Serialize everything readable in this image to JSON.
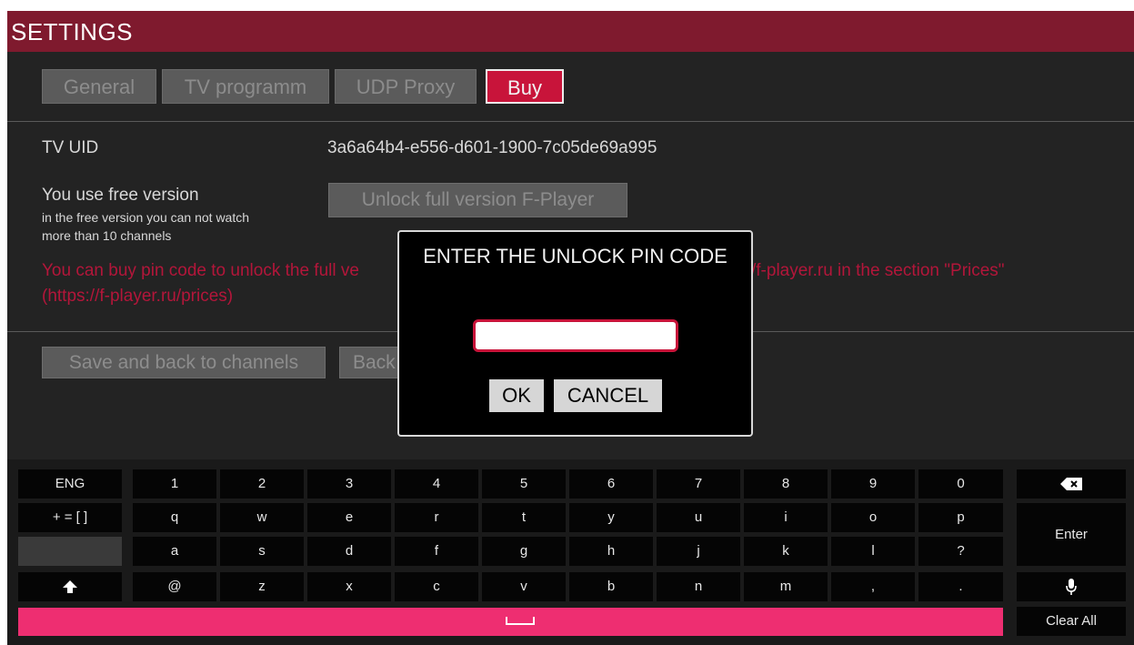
{
  "header": {
    "title": "SETTINGS"
  },
  "tabs": [
    {
      "label": "General"
    },
    {
      "label": "TV programm"
    },
    {
      "label": "UDP Proxy"
    },
    {
      "label": "Buy"
    }
  ],
  "info": {
    "uid_label": "TV UID",
    "uid_value": "3a6a64b4-e556-d601-1900-7c05de69a995",
    "free_title": "You use free version",
    "free_note_1": "in the free version you can not watch",
    "free_note_2": "more than 10 channels",
    "unlock_button": "Unlock full version F-Player",
    "buy_text_left": "You can buy pin code to unlock the full ve",
    "buy_text_right": "/f-player.ru in the section \"Prices\"",
    "buy_url": "(https://f-player.ru/prices)"
  },
  "actions": {
    "save_label": "Save and back to channels",
    "back_label": "Back"
  },
  "dialog": {
    "title": "ENTER THE UNLOCK PIN CODE",
    "pin_value": "",
    "ok": "OK",
    "cancel": "CANCEL"
  },
  "keyboard": {
    "lang": "ENG",
    "symbols": "+ = [ ]",
    "row1": [
      "1",
      "2",
      "3",
      "4",
      "5",
      "6",
      "7",
      "8",
      "9",
      "0"
    ],
    "row2": [
      "q",
      "w",
      "e",
      "r",
      "t",
      "y",
      "u",
      "i",
      "o",
      "p"
    ],
    "row3": [
      "a",
      "s",
      "d",
      "f",
      "g",
      "h",
      "j",
      "k",
      "l",
      "?"
    ],
    "row4": [
      "@",
      "z",
      "x",
      "c",
      "v",
      "b",
      "n",
      "m",
      ",",
      "."
    ],
    "enter": "Enter",
    "clear": "Clear All",
    "icons": {
      "backspace": "backspace-icon",
      "shift": "shift-icon",
      "mic": "microphone-icon",
      "space": "space-icon"
    }
  },
  "colors": {
    "accent": "#c8143a",
    "title_bar": "#7f1a2e",
    "space_bar": "#ee2e71"
  }
}
